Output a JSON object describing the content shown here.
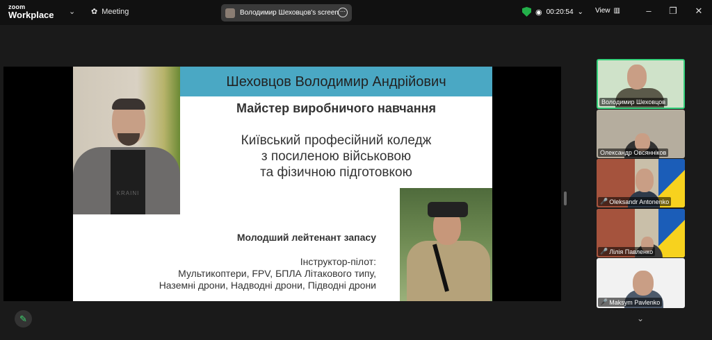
{
  "app": {
    "brand_top": "zoom",
    "brand_bottom": "Workplace"
  },
  "toolbar": {
    "meeting_label": "Meeting",
    "view_label": "View",
    "timer": "00:20:54"
  },
  "share": {
    "label": "Володимир Шеховцов's screen"
  },
  "slide": {
    "name": "Шеховцов Володимир Андрійович",
    "position": "Майстер виробничого навчання",
    "college": "Київський професійний коледж\nз посиленою військовою\nта фізичною підготовкою",
    "rank": "Молодший лейтенант запасу",
    "instructor": "Інструктор-пілот:\nМультикоптери, FPV, БПЛА Літакового типу,\nНаземні дрони, Надводні дрони, Підводні дрони",
    "shirt_text": "KRAINI"
  },
  "participants": [
    {
      "name": "Володимир Шеховцов",
      "muted": false
    },
    {
      "name": "Олександр Овсяннiков",
      "muted": false
    },
    {
      "name": "Oleksandr Antonenko",
      "muted": true
    },
    {
      "name": "Лiлiя Павленко",
      "muted": true
    },
    {
      "name": "Maksym Pavlenko",
      "muted": true
    }
  ],
  "colors": {
    "accent": "#35d27c",
    "banner": "#4aa8c4",
    "shield": "#23b04a"
  }
}
